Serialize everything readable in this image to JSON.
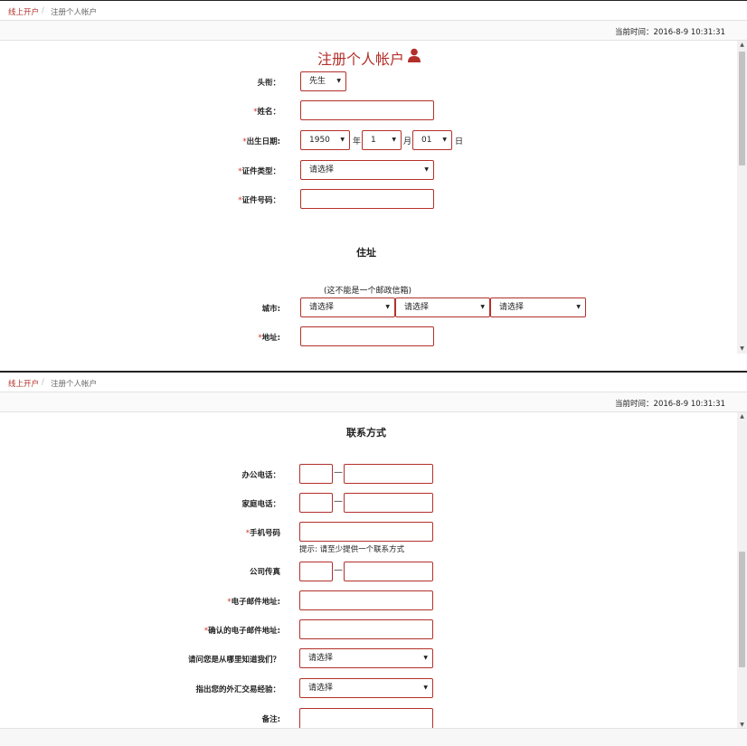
{
  "breadcrumb": {
    "link": "线上开户",
    "separator": "/",
    "current": "注册个人帐户"
  },
  "time": {
    "label": "当前时间：",
    "value": "2016-8-9 10:31:31"
  },
  "page_title": "注册个人帐户",
  "icons": {
    "title": "user-icon"
  },
  "colors": {
    "accent": "#b3302a"
  },
  "personal": {
    "salutation": {
      "label": "头衔：",
      "value": "先生"
    },
    "name": {
      "label": "姓名：",
      "required": "*"
    },
    "birth": {
      "label": "出生日期:",
      "required": "*",
      "year": "1950",
      "year_unit": "年",
      "month": "1",
      "month_unit": "月",
      "day": "01",
      "day_unit": "日"
    },
    "id_type": {
      "label": "证件类型：",
      "required": "*",
      "value": "请选择"
    },
    "id_number": {
      "label": "证件号码：",
      "required": "*"
    }
  },
  "address": {
    "heading": "住址",
    "note": "(这不能是一个邮政信箱)",
    "city": {
      "label": "城市:",
      "select1": "请选择",
      "select2": "请选择",
      "select3": "请选择"
    },
    "street": {
      "label": "地址:",
      "required": "*"
    }
  },
  "contact": {
    "heading": "联系方式",
    "office_phone": {
      "label": "办公电话：",
      "dash": "—"
    },
    "home_phone": {
      "label": "家庭电话：",
      "dash": "—"
    },
    "mobile": {
      "label": "手机号码",
      "required": "*",
      "hint": "提示: 请至少提供一个联系方式"
    },
    "fax": {
      "label": "公司传真",
      "dash": "—"
    },
    "email": {
      "label": "电子邮件地址:",
      "required": "*"
    },
    "email_confirm": {
      "label": "确认的电子邮件地址:",
      "required": "*"
    },
    "referral": {
      "label": "请问您是从哪里知道我们？",
      "value": "请选择"
    },
    "fx_experience": {
      "label": "指出您的外汇交易经验：",
      "value": "请选择"
    },
    "remarks": {
      "label": "备注:"
    }
  }
}
